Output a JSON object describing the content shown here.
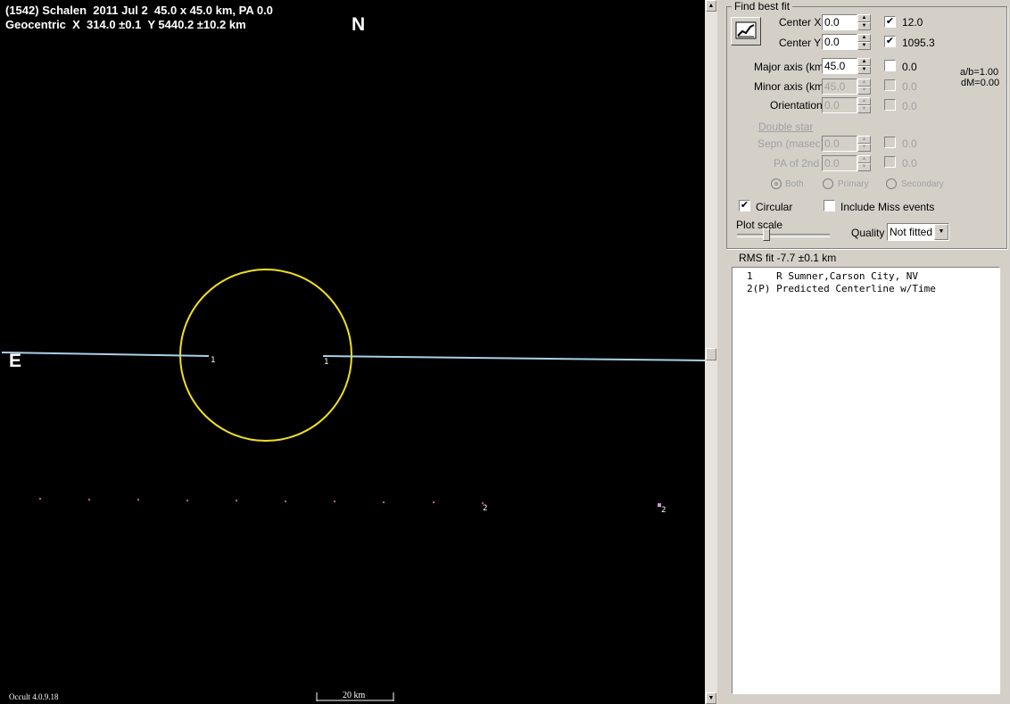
{
  "plot": {
    "title_line1": "(1542) Schalen  2011 Jul 2  45.0 x 45.0 km, PA 0.0",
    "title_line2": "Geocentric  X  314.0 ±0.1  Y 5440.2 ±10.2 km",
    "north_label": "N",
    "east_label": "E",
    "chord_label_left": "1",
    "chord_label_right": "1",
    "predicted_label_1": "2",
    "predicted_label_2": "2",
    "version": "Occult 4.0.9.18",
    "scale_bar": "20 km",
    "colors": {
      "background": "#000000",
      "ellipse": "#f0e020",
      "chord": "#a8d0e8",
      "predicted": "#c06060"
    }
  },
  "panel": {
    "group_title": "Find best fit",
    "fit_button_icon": "chart-fit-icon",
    "center_x": {
      "label": "Center X",
      "value": "0.0",
      "checked": true,
      "result": "12.0"
    },
    "center_y": {
      "label": "Center Y",
      "value": "0.0",
      "checked": true,
      "result": "1095.3"
    },
    "major_axis": {
      "label": "Major axis (km)",
      "value": "45.0",
      "checked": false,
      "result": "0.0"
    },
    "minor_axis": {
      "label": "Minor axis (km)",
      "value": "45.0",
      "checked": false,
      "result": "0.0"
    },
    "orientation": {
      "label": "Orientation",
      "value": "0.0",
      "checked": false,
      "result": "0.0"
    },
    "ab_ratio": "a/b=1.00",
    "dm": "dM=0.00",
    "double_star": "Double star",
    "sepn": {
      "label": "Sepn (masec)",
      "value": "0.0",
      "checked": false,
      "result": "0.0"
    },
    "pa2nd": {
      "label": "PA of 2nd",
      "value": "0.0",
      "checked": false,
      "result": "0.0"
    },
    "radio_both": "Both",
    "radio_primary": "Primary",
    "radio_secondary": "Secondary",
    "circular_label": "Circular",
    "circular_checked": true,
    "miss_label": "Include Miss events",
    "miss_checked": false,
    "plot_scale_label": "Plot scale",
    "quality_label": "Quality",
    "quality_value": "Not fitted",
    "rms_fit": "RMS fit  -7.7 ±0.1 km"
  },
  "observers": [
    {
      "text": "1    R Sumner,Carson City, NV"
    },
    {
      "text": "2(P) Predicted Centerline w/Time"
    }
  ]
}
